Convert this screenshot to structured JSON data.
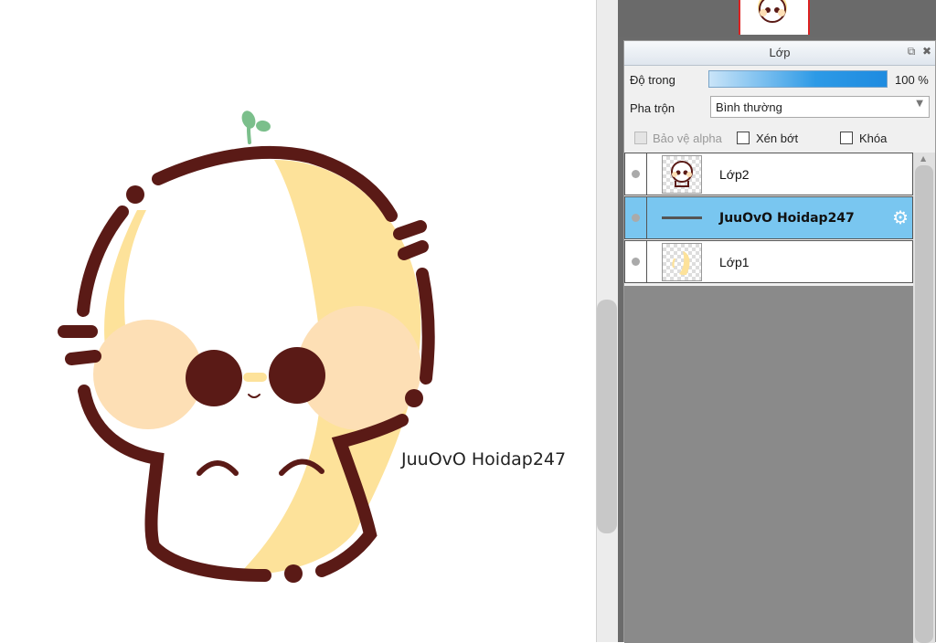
{
  "canvas": {
    "text": "JuuOvO Hoidap247",
    "colors": {
      "outline": "#5a1a16",
      "cream": "#fde29a",
      "cheek": "#fddfb5",
      "sprout": "#7bbf8b"
    }
  },
  "layer_panel": {
    "title": "Lớp",
    "opacity_label": "Độ trong",
    "opacity_value": "100 %",
    "opacity_fraction": 1.0,
    "blend_label": "Pha trộn",
    "blend_value": "Bình thường",
    "protect_alpha_label": "Bảo vệ alpha",
    "clip_label": "Xén bớt",
    "lock_label": "Khóa",
    "layers": [
      {
        "name": "Lớp2",
        "selected": false
      },
      {
        "name": "JuuOvO Hoidap247",
        "selected": true
      },
      {
        "name": "Lớp1",
        "selected": false
      }
    ],
    "accent": "#79c6f0"
  },
  "icons": {
    "float": "external-window-icon",
    "close": "close-icon",
    "settings": "gear-icon",
    "dropdown": "chevron-down-icon",
    "visibility": "eye-dot-icon"
  }
}
